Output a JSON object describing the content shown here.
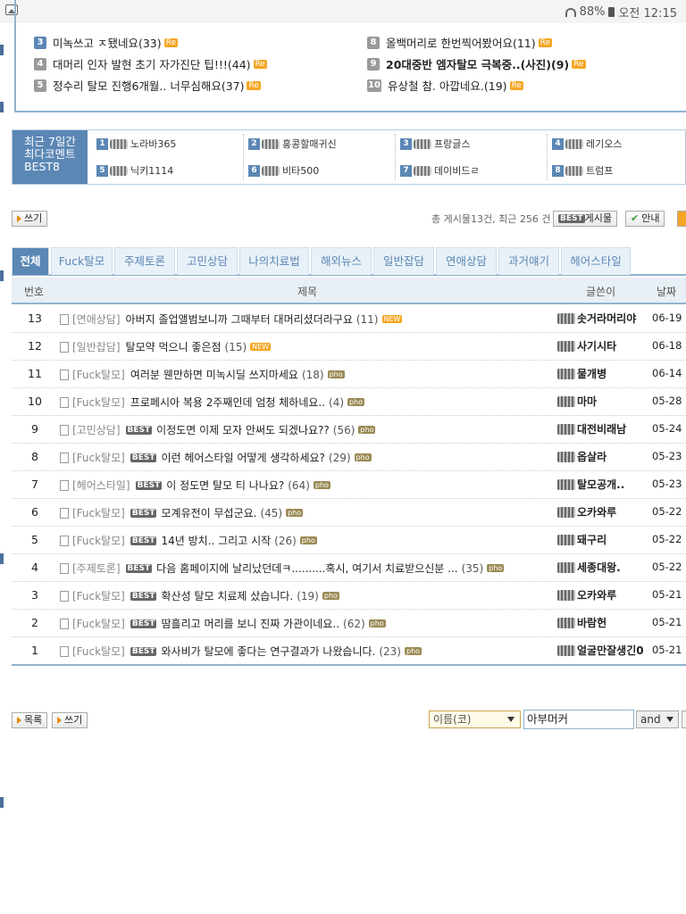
{
  "statusbar": {
    "battery": "88%",
    "time": "오전 12:15"
  },
  "top_ranks": {
    "left": [
      {
        "num": "3",
        "text": "미녹쓰고 ㅈ됐네요(33)"
      },
      {
        "num": "4",
        "text": "대머리 인자 발현 초기 자가진단 팁!!!(44)"
      },
      {
        "num": "5",
        "text": "정수리 탈모 진행6개월.. 너무심해요(37)"
      }
    ],
    "right": [
      {
        "num": "8",
        "text": "올백머리로 한번찍어봤어요(11)"
      },
      {
        "num": "9",
        "text": "20대중반 엠자탈모 극복중..(사진)(9)"
      },
      {
        "num": "10",
        "text": "유상철 참. 아깝네요.(19)"
      }
    ],
    "re_label": "Re"
  },
  "best8": {
    "label_line1": "최근 7일간",
    "label_line2": "최다코멘트",
    "label_line3": "BEST8",
    "users": [
      {
        "num": "1",
        "name": "노라바365"
      },
      {
        "num": "2",
        "name": "홍콩할매귀신"
      },
      {
        "num": "3",
        "name": "프랑글스"
      },
      {
        "num": "4",
        "name": "레기오스"
      },
      {
        "num": "5",
        "name": "닉키1114"
      },
      {
        "num": "6",
        "name": "비타500"
      },
      {
        "num": "7",
        "name": "데이비드ㄹ"
      },
      {
        "num": "8",
        "name": "트럼프"
      }
    ]
  },
  "toolbar": {
    "write_label": "쓰기",
    "info_text": "총 게시물13건, 최근 256 건",
    "best_label": "BEST",
    "best_board_label": "게시물",
    "guide_label": "안내"
  },
  "tabs": [
    "전체",
    "Fuck탈모",
    "주제토론",
    "고민상담",
    "나의치료법",
    "해외뉴스",
    "일반잡담",
    "연애상담",
    "과거얘기",
    "헤어스타일"
  ],
  "table": {
    "headers": {
      "no": "번호",
      "title": "제목",
      "author": "글쓴이",
      "date": "날짜"
    },
    "best_badge": "BEST",
    "new_badge": "NEW",
    "pho_badge": "pho",
    "rows": [
      {
        "no": "13",
        "cat": "[연애상담]",
        "title": "아버지 졸업앨범보니까 그때부터 대머리셨더라구요",
        "cmt": "(11)",
        "author": "솟거라머리야",
        "date": "06-19"
      },
      {
        "no": "12",
        "cat": "[일반잡담]",
        "title": "탈모약 먹으니 좋은점",
        "cmt": "(15)",
        "author": "사기시타",
        "date": "06-18"
      },
      {
        "no": "11",
        "cat": "[Fuck탈모]",
        "title": "여러분 웬만하면 미녹시딜 쓰지마세요",
        "cmt": "(18)",
        "author": "물개병",
        "date": "06-14"
      },
      {
        "no": "10",
        "cat": "[Fuck탈모]",
        "title": "프로페시아 복용 2주째인데 엄청 체하네요..",
        "cmt": "(4)",
        "author": "마마",
        "date": "05-28"
      },
      {
        "no": "9",
        "cat": "[고민상담]",
        "title": "이정도면 이제 모자 안써도 되겠나요??",
        "cmt": "(56)",
        "author": "대전비래남",
        "date": "05-24"
      },
      {
        "no": "8",
        "cat": "[Fuck탈모]",
        "title": "이런 헤어스타일 어떻게 생각하세요?",
        "cmt": "(29)",
        "author": "옵살라",
        "date": "05-23"
      },
      {
        "no": "7",
        "cat": "[헤어스타일]",
        "title": "이 정도면 탈모 티 나나요?",
        "cmt": "(64)",
        "author": "탈모공개..",
        "date": "05-23"
      },
      {
        "no": "6",
        "cat": "[Fuck탈모]",
        "title": "모계유전이 무섭군요.",
        "cmt": "(45)",
        "author": "오카와루",
        "date": "05-22"
      },
      {
        "no": "5",
        "cat": "[Fuck탈모]",
        "title": "14년 방치.. 그리고 시작",
        "cmt": "(26)",
        "author": "돼구리",
        "date": "05-22"
      },
      {
        "no": "4",
        "cat": "[주제토론]",
        "title": "다음 홈페이지에 날리났던데ㅋ..........혹시, 여기서 치료받으신분 ...",
        "cmt": "(35)",
        "author": "세종대왕.",
        "date": "05-22"
      },
      {
        "no": "3",
        "cat": "[Fuck탈모]",
        "title": "확산성 탈모 치료제 샀습니다.",
        "cmt": "(19)",
        "author": "오카와루",
        "date": "05-21"
      },
      {
        "no": "2",
        "cat": "[Fuck탈모]",
        "title": "땀흘리고 머리를 보니 진짜 가관이네요..",
        "cmt": "(62)",
        "author": "바람헌",
        "date": "05-21"
      },
      {
        "no": "1",
        "cat": "[Fuck탈모]",
        "title": "와사비가 탈모에 좋다는 연구결과가 나왔습니다.",
        "cmt": "(23)",
        "author": "얼굴만잘생긴0",
        "date": "05-21"
      }
    ]
  },
  "bottom": {
    "list_label": "목록",
    "write_label": "쓰기",
    "search_select": "이름(코)",
    "search_value": "아부머커",
    "and_label": "and"
  }
}
